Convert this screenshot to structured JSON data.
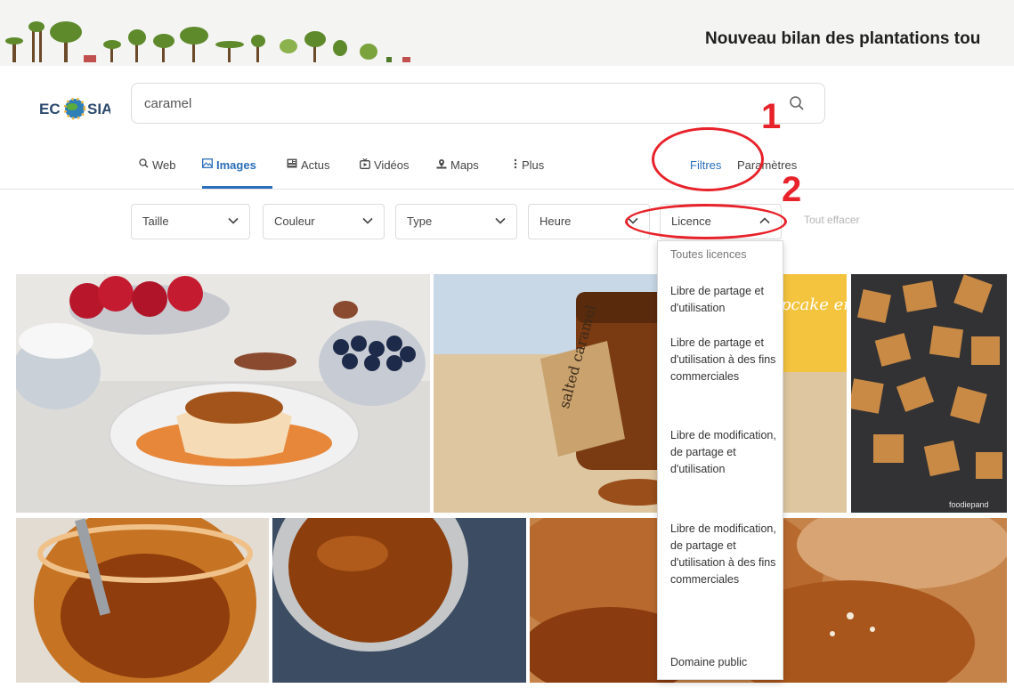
{
  "banner": {
    "title": "Nouveau bilan des plantations tou"
  },
  "logo": {
    "text": "ECOSIA"
  },
  "search": {
    "value": "caramel"
  },
  "nav": {
    "items": [
      {
        "label": "Web",
        "icon": "search-icon"
      },
      {
        "label": "Images",
        "icon": "image-icon",
        "active": true
      },
      {
        "label": "Actus",
        "icon": "news-icon"
      },
      {
        "label": "Vidéos",
        "icon": "video-icon"
      },
      {
        "label": "Maps",
        "icon": "map-icon"
      },
      {
        "label": "Plus",
        "icon": "more-icon"
      }
    ],
    "filters_link": "Filtres",
    "settings_link": "Paramètres"
  },
  "filters": {
    "size": "Taille",
    "color": "Couleur",
    "type": "Type",
    "time": "Heure",
    "license": "Licence",
    "clear_all": "Tout effacer"
  },
  "license_options": [
    "Toutes licences",
    "Libre de partage et d'utilisation",
    "Libre de partage et d'utilisation à des fins commerciales",
    "Libre de modification, de partage et d'utilisation",
    "Libre de modification, de partage et d'utilisation à des fins commerciales",
    "Domaine public"
  ],
  "image_texts": {
    "jar_label": "salted caramel",
    "cupcake_sign": "pcake emma",
    "credit": "foodiepand"
  },
  "annotations": {
    "one": "1",
    "two": "2"
  },
  "colors": {
    "accent": "#2a6ebb",
    "annotation": "#e8222a"
  }
}
